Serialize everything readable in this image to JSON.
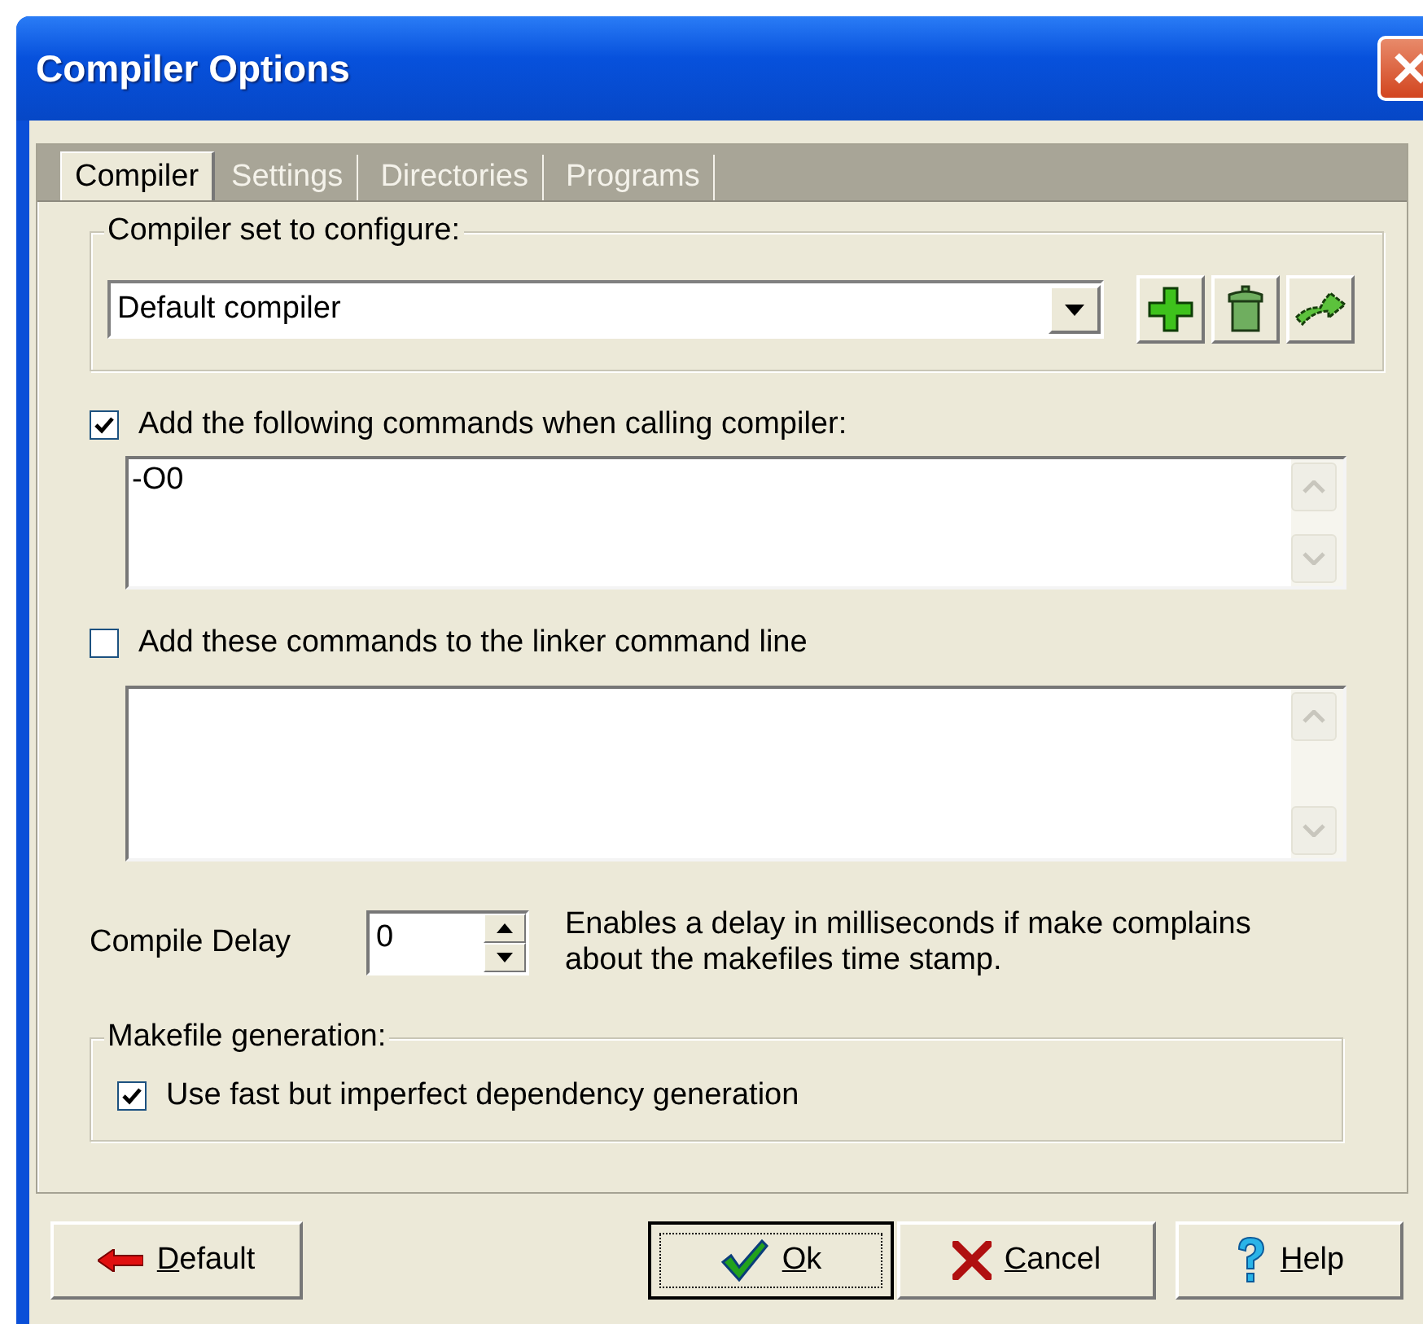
{
  "window": {
    "title": "Compiler Options"
  },
  "tabs": [
    {
      "label": "Compiler",
      "selected": true
    },
    {
      "label": "Settings",
      "selected": false
    },
    {
      "label": "Directories",
      "selected": false
    },
    {
      "label": "Programs",
      "selected": false
    }
  ],
  "compiler_set": {
    "label": "Compiler set to configure:",
    "value": "Default compiler"
  },
  "compiler_commands": {
    "label": "Add the following commands when calling compiler:",
    "checked": true,
    "value": "-O0"
  },
  "linker_commands": {
    "label": "Add these commands to the linker command line",
    "checked": false
  },
  "compile_delay": {
    "label": "Compile Delay",
    "value": "0",
    "description": "Enables a delay in milliseconds if make complains about the makefiles time stamp."
  },
  "makefile_generation": {
    "label": "Makefile generation:",
    "option": {
      "label": "Use fast but imperfect dependency generation",
      "checked": true
    }
  },
  "buttons": [
    {
      "label": "Default",
      "kind": "default",
      "focused": false
    },
    {
      "label": "Ok",
      "kind": "ok",
      "focused": true
    },
    {
      "label": "Cancel",
      "kind": "cancel",
      "focused": false
    },
    {
      "label": "Help",
      "kind": "help",
      "focused": false
    }
  ]
}
